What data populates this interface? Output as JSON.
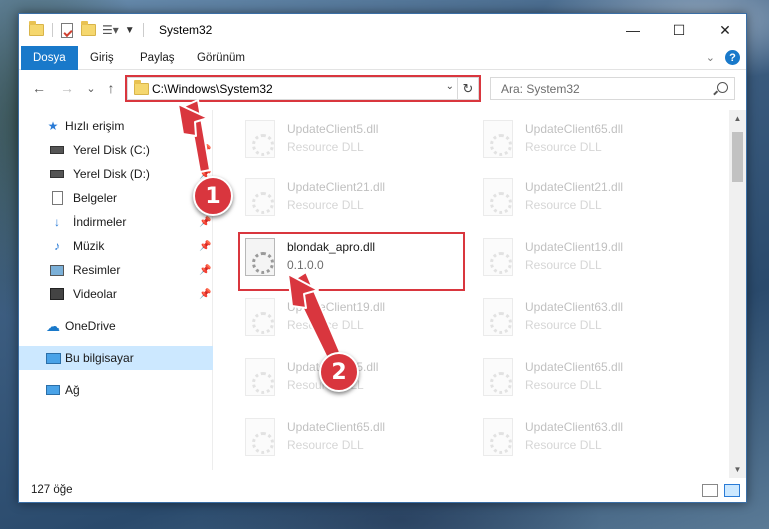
{
  "window": {
    "title": "System32"
  },
  "window_controls": {
    "minimize": "—",
    "maximize": "☐",
    "close": "✕"
  },
  "ribbon": {
    "tabs": [
      {
        "label": "Dosya",
        "active": true
      },
      {
        "label": "Giriş"
      },
      {
        "label": "Paylaş"
      },
      {
        "label": "Görünüm"
      }
    ],
    "help": "?"
  },
  "navigation": {
    "back": "←",
    "forward": "→",
    "recent": "⌄",
    "up": "↑",
    "address": "C:\\Windows\\System32",
    "refresh": "↻",
    "search_placeholder": "Ara: System32"
  },
  "sidebar": {
    "items": [
      {
        "label": "Hızlı erişim",
        "icon": "star-icon"
      },
      {
        "label": "Yerel Disk (C:)",
        "icon": "drive-icon",
        "pinned": true
      },
      {
        "label": "Yerel Disk (D:)",
        "icon": "drive-icon",
        "pinned": true
      },
      {
        "label": "Belgeler",
        "icon": "documents-icon",
        "pinned": true
      },
      {
        "label": "İndirmeler",
        "icon": "download-icon",
        "pinned": true
      },
      {
        "label": "Müzik",
        "icon": "music-icon",
        "pinned": true
      },
      {
        "label": "Resimler",
        "icon": "pictures-icon",
        "pinned": true
      },
      {
        "label": "Videolar",
        "icon": "videos-icon",
        "pinned": true
      },
      {
        "label": "OneDrive",
        "icon": "cloud-icon"
      },
      {
        "label": "Bu bilgisayar",
        "icon": "computer-icon",
        "selected": true
      },
      {
        "label": "Ağ",
        "icon": "network-icon"
      }
    ]
  },
  "files": [
    {
      "name": "UpdateClient5.dll",
      "desc": "Resource DLL"
    },
    {
      "name": "UpdateClient65.dll",
      "desc": "Resource DLL"
    },
    {
      "name": "UpdateClient21.dll",
      "desc": "Resource DLL"
    },
    {
      "name": "UpdateClient21.dll",
      "desc": "Resource DLL"
    },
    {
      "name": "blondak_apro.dll",
      "desc": "0.1.0.0",
      "highlighted": true
    },
    {
      "name": "UpdateClient19.dll",
      "desc": "Resource DLL"
    },
    {
      "name": "UpdateClient19.dll",
      "desc": "Resource DLL"
    },
    {
      "name": "UpdateClient63.dll",
      "desc": "Resource DLL"
    },
    {
      "name": "UpdateClient5.dll",
      "desc": "Resource DLL"
    },
    {
      "name": "UpdateClient65.dll",
      "desc": "Resource DLL"
    },
    {
      "name": "UpdateClient65.dll",
      "desc": "Resource DLL"
    },
    {
      "name": "UpdateClient63.dll",
      "desc": "Resource DLL"
    }
  ],
  "status": {
    "count": "127 öğe"
  },
  "annotations": {
    "step1": "1",
    "step2": "2",
    "color": "#d9363e"
  }
}
